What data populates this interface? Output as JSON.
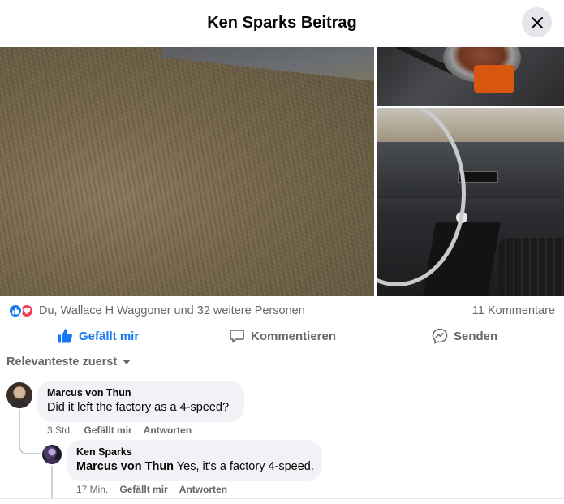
{
  "header": {
    "title": "Ken Sparks Beitrag"
  },
  "colors": {
    "brand": "#1877f2",
    "love": "#f33e58",
    "secondary_text": "#65676b",
    "bubble": "#f0f2f5"
  },
  "icons": {
    "close": "close-icon",
    "like_reaction": "thumbs-up-icon",
    "love_reaction": "heart-icon",
    "like_action": "thumbs-up-icon",
    "comment_action": "speech-bubble-icon",
    "send_action": "messenger-icon",
    "sort": "caret-down-icon"
  },
  "post": {
    "reactions_text": "Du, Wallace H Waggoner und 32 weitere Personen",
    "comments_count": "11 Kommentare"
  },
  "actions": {
    "like": "Gefällt mir",
    "comment": "Kommentieren",
    "send": "Senden"
  },
  "sort": {
    "label": "Relevanteste zuerst"
  },
  "comments": [
    {
      "author": "Marcus von Thun",
      "text": "Did it left the factory as a 4-speed?",
      "time": "3 Std.",
      "like": "Gefällt mir",
      "reply": "Antworten"
    },
    {
      "author": "Ken Sparks",
      "mention": "Marcus von Thun",
      "text": "Yes, it's a factory 4-speed.",
      "time": "17 Min.",
      "like": "Gefällt mir",
      "reply": "Antworten"
    }
  ]
}
